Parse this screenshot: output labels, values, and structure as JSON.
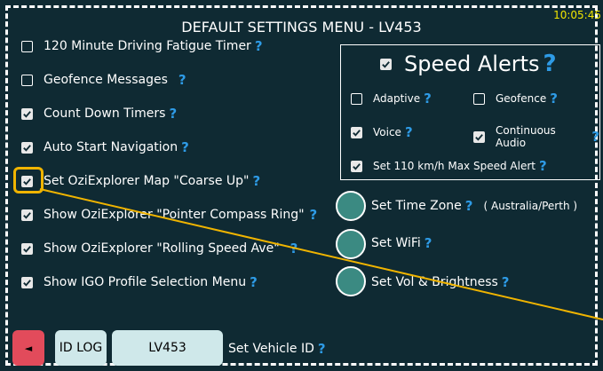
{
  "header": {
    "title": "DEFAULT SETTINGS MENU - LV453",
    "clock": "10:05:45"
  },
  "help_glyph": "?",
  "settings": [
    {
      "label": "120 Minute Driving Fatigue Timer",
      "checked": false
    },
    {
      "label": "Geofence Messages",
      "checked": false
    },
    {
      "label": "Count Down Timers",
      "checked": true
    },
    {
      "label": "Auto Start Navigation",
      "checked": true
    },
    {
      "label": "Set OziExplorer Map \"Coarse Up\"",
      "checked": true
    },
    {
      "label": "Show OziExplorer \"Pointer Compass Ring\"",
      "checked": true
    },
    {
      "label": "Show OziExplorer \"Rolling Speed Ave\"",
      "checked": true
    },
    {
      "label": "Show IGO Profile Selection Menu",
      "checked": true
    }
  ],
  "speed_alerts": {
    "title": "Speed Alerts",
    "enabled": true,
    "options": [
      {
        "label": "Adaptive",
        "checked": false
      },
      {
        "label": "Geofence",
        "checked": false
      },
      {
        "label": "Voice",
        "checked": true
      },
      {
        "label": "Continuous Audio",
        "checked": true
      },
      {
        "label": "Set 110 km/h Max Speed Alert",
        "checked": true
      }
    ]
  },
  "actions": {
    "time_zone_label": "Set Time Zone",
    "time_zone_value": "( Australia/Perth )",
    "wifi_label": "Set WiFi",
    "vol_label": "Set Vol & Brightness"
  },
  "footer": {
    "back_glyph": "◄",
    "id_log_label": "ID LOG",
    "vehicle_button_label": "LV453",
    "set_vehicle_label": "Set Vehicle ID"
  },
  "colors": {
    "background": "#0f2a33",
    "help_blue": "#2e9be6",
    "clock_yellow": "#f2e600",
    "back_red": "#e24b5b",
    "button_light": "#cfe8ea",
    "circle_teal": "#3b8a82",
    "focus_orange": "#f0b400"
  }
}
